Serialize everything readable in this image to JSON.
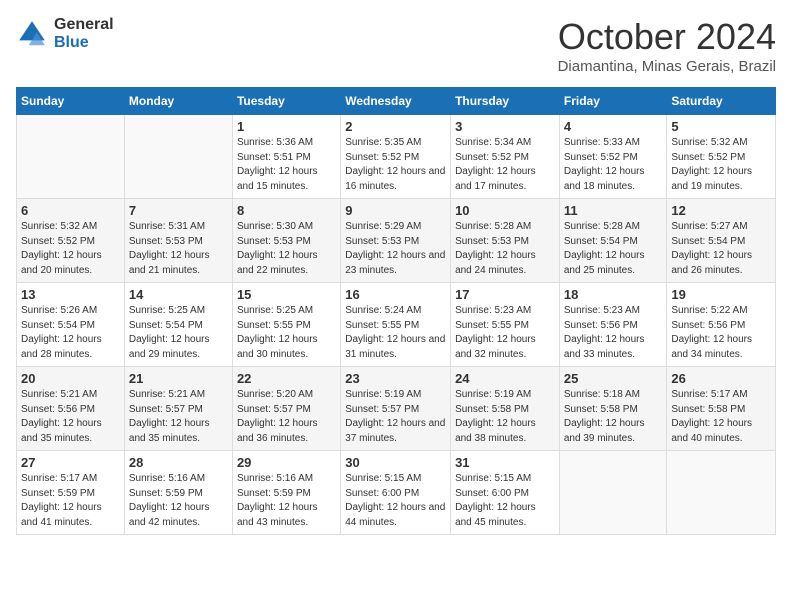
{
  "header": {
    "logo": {
      "general": "General",
      "blue": "Blue"
    },
    "title": "October 2024",
    "subtitle": "Diamantina, Minas Gerais, Brazil"
  },
  "calendar": {
    "columns": [
      "Sunday",
      "Monday",
      "Tuesday",
      "Wednesday",
      "Thursday",
      "Friday",
      "Saturday"
    ],
    "weeks": [
      [
        {
          "day": "",
          "sunrise": "",
          "sunset": "",
          "daylight": ""
        },
        {
          "day": "",
          "sunrise": "",
          "sunset": "",
          "daylight": ""
        },
        {
          "day": "1",
          "sunrise": "Sunrise: 5:36 AM",
          "sunset": "Sunset: 5:51 PM",
          "daylight": "Daylight: 12 hours and 15 minutes."
        },
        {
          "day": "2",
          "sunrise": "Sunrise: 5:35 AM",
          "sunset": "Sunset: 5:52 PM",
          "daylight": "Daylight: 12 hours and 16 minutes."
        },
        {
          "day": "3",
          "sunrise": "Sunrise: 5:34 AM",
          "sunset": "Sunset: 5:52 PM",
          "daylight": "Daylight: 12 hours and 17 minutes."
        },
        {
          "day": "4",
          "sunrise": "Sunrise: 5:33 AM",
          "sunset": "Sunset: 5:52 PM",
          "daylight": "Daylight: 12 hours and 18 minutes."
        },
        {
          "day": "5",
          "sunrise": "Sunrise: 5:32 AM",
          "sunset": "Sunset: 5:52 PM",
          "daylight": "Daylight: 12 hours and 19 minutes."
        }
      ],
      [
        {
          "day": "6",
          "sunrise": "Sunrise: 5:32 AM",
          "sunset": "Sunset: 5:52 PM",
          "daylight": "Daylight: 12 hours and 20 minutes."
        },
        {
          "day": "7",
          "sunrise": "Sunrise: 5:31 AM",
          "sunset": "Sunset: 5:53 PM",
          "daylight": "Daylight: 12 hours and 21 minutes."
        },
        {
          "day": "8",
          "sunrise": "Sunrise: 5:30 AM",
          "sunset": "Sunset: 5:53 PM",
          "daylight": "Daylight: 12 hours and 22 minutes."
        },
        {
          "day": "9",
          "sunrise": "Sunrise: 5:29 AM",
          "sunset": "Sunset: 5:53 PM",
          "daylight": "Daylight: 12 hours and 23 minutes."
        },
        {
          "day": "10",
          "sunrise": "Sunrise: 5:28 AM",
          "sunset": "Sunset: 5:53 PM",
          "daylight": "Daylight: 12 hours and 24 minutes."
        },
        {
          "day": "11",
          "sunrise": "Sunrise: 5:28 AM",
          "sunset": "Sunset: 5:54 PM",
          "daylight": "Daylight: 12 hours and 25 minutes."
        },
        {
          "day": "12",
          "sunrise": "Sunrise: 5:27 AM",
          "sunset": "Sunset: 5:54 PM",
          "daylight": "Daylight: 12 hours and 26 minutes."
        }
      ],
      [
        {
          "day": "13",
          "sunrise": "Sunrise: 5:26 AM",
          "sunset": "Sunset: 5:54 PM",
          "daylight": "Daylight: 12 hours and 28 minutes."
        },
        {
          "day": "14",
          "sunrise": "Sunrise: 5:25 AM",
          "sunset": "Sunset: 5:54 PM",
          "daylight": "Daylight: 12 hours and 29 minutes."
        },
        {
          "day": "15",
          "sunrise": "Sunrise: 5:25 AM",
          "sunset": "Sunset: 5:55 PM",
          "daylight": "Daylight: 12 hours and 30 minutes."
        },
        {
          "day": "16",
          "sunrise": "Sunrise: 5:24 AM",
          "sunset": "Sunset: 5:55 PM",
          "daylight": "Daylight: 12 hours and 31 minutes."
        },
        {
          "day": "17",
          "sunrise": "Sunrise: 5:23 AM",
          "sunset": "Sunset: 5:55 PM",
          "daylight": "Daylight: 12 hours and 32 minutes."
        },
        {
          "day": "18",
          "sunrise": "Sunrise: 5:23 AM",
          "sunset": "Sunset: 5:56 PM",
          "daylight": "Daylight: 12 hours and 33 minutes."
        },
        {
          "day": "19",
          "sunrise": "Sunrise: 5:22 AM",
          "sunset": "Sunset: 5:56 PM",
          "daylight": "Daylight: 12 hours and 34 minutes."
        }
      ],
      [
        {
          "day": "20",
          "sunrise": "Sunrise: 5:21 AM",
          "sunset": "Sunset: 5:56 PM",
          "daylight": "Daylight: 12 hours and 35 minutes."
        },
        {
          "day": "21",
          "sunrise": "Sunrise: 5:21 AM",
          "sunset": "Sunset: 5:57 PM",
          "daylight": "Daylight: 12 hours and 35 minutes."
        },
        {
          "day": "22",
          "sunrise": "Sunrise: 5:20 AM",
          "sunset": "Sunset: 5:57 PM",
          "daylight": "Daylight: 12 hours and 36 minutes."
        },
        {
          "day": "23",
          "sunrise": "Sunrise: 5:19 AM",
          "sunset": "Sunset: 5:57 PM",
          "daylight": "Daylight: 12 hours and 37 minutes."
        },
        {
          "day": "24",
          "sunrise": "Sunrise: 5:19 AM",
          "sunset": "Sunset: 5:58 PM",
          "daylight": "Daylight: 12 hours and 38 minutes."
        },
        {
          "day": "25",
          "sunrise": "Sunrise: 5:18 AM",
          "sunset": "Sunset: 5:58 PM",
          "daylight": "Daylight: 12 hours and 39 minutes."
        },
        {
          "day": "26",
          "sunrise": "Sunrise: 5:17 AM",
          "sunset": "Sunset: 5:58 PM",
          "daylight": "Daylight: 12 hours and 40 minutes."
        }
      ],
      [
        {
          "day": "27",
          "sunrise": "Sunrise: 5:17 AM",
          "sunset": "Sunset: 5:59 PM",
          "daylight": "Daylight: 12 hours and 41 minutes."
        },
        {
          "day": "28",
          "sunrise": "Sunrise: 5:16 AM",
          "sunset": "Sunset: 5:59 PM",
          "daylight": "Daylight: 12 hours and 42 minutes."
        },
        {
          "day": "29",
          "sunrise": "Sunrise: 5:16 AM",
          "sunset": "Sunset: 5:59 PM",
          "daylight": "Daylight: 12 hours and 43 minutes."
        },
        {
          "day": "30",
          "sunrise": "Sunrise: 5:15 AM",
          "sunset": "Sunset: 6:00 PM",
          "daylight": "Daylight: 12 hours and 44 minutes."
        },
        {
          "day": "31",
          "sunrise": "Sunrise: 5:15 AM",
          "sunset": "Sunset: 6:00 PM",
          "daylight": "Daylight: 12 hours and 45 minutes."
        },
        {
          "day": "",
          "sunrise": "",
          "sunset": "",
          "daylight": ""
        },
        {
          "day": "",
          "sunrise": "",
          "sunset": "",
          "daylight": ""
        }
      ]
    ]
  }
}
